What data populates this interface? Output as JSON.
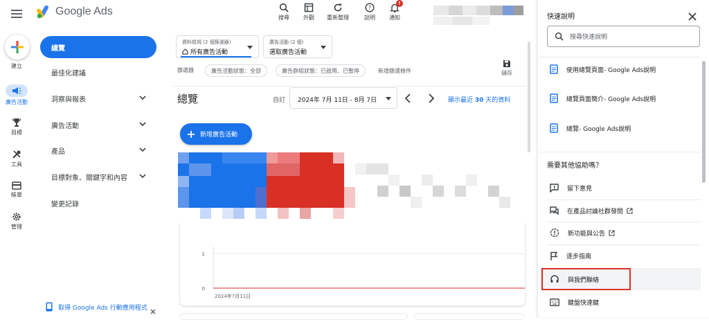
{
  "header": {
    "app_name": "Google Ads",
    "tools": [
      {
        "icon": "search-icon",
        "label": "搜尋"
      },
      {
        "icon": "appearance-icon",
        "label": "外觀"
      },
      {
        "icon": "refresh-icon",
        "label": "重新整理"
      },
      {
        "icon": "help-icon",
        "label": "說明"
      },
      {
        "icon": "bell-icon",
        "label": "通知",
        "badge": "!"
      }
    ]
  },
  "rail": {
    "create_label": "建立",
    "items": [
      {
        "icon": "campaign-icon",
        "label": "廣告活動"
      },
      {
        "icon": "trophy-icon",
        "label": "目標"
      },
      {
        "icon": "tools-icon",
        "label": "工具"
      },
      {
        "icon": "billing-icon",
        "label": "帳單"
      },
      {
        "icon": "gear-icon",
        "label": "管理"
      }
    ]
  },
  "sidebar": {
    "items": [
      {
        "label": "總覽",
        "active": true
      },
      {
        "label": "最佳化建議"
      },
      {
        "label": "洞察與報表",
        "expandable": true
      },
      {
        "label": "廣告活動",
        "expandable": true
      },
      {
        "label": "產品",
        "expandable": true
      },
      {
        "label": "目標對象、關鍵字和內容",
        "expandable": true
      },
      {
        "label": "變更記錄"
      }
    ],
    "promo": "取得 Google Ads 行動應用程式"
  },
  "selectors": {
    "view_caption": "資料檢視 (2 個篩選器)",
    "view_value": "所有廣告活動",
    "campaign_caption": "廣告活動 (2 個)",
    "campaign_value": "選取廣告活動"
  },
  "filters": {
    "label": "篩選器",
    "chips": [
      "廣告活動狀態：全部",
      "廣告群組狀態：已啟用、已暫停"
    ],
    "add": "新增篩選條件",
    "save": "儲存"
  },
  "overview": {
    "title": "總覽",
    "date_label": "自訂",
    "date_range": "2024年 7月 11日 - 8月 7日",
    "show_recent": "顯示最近",
    "recent_days": "30",
    "recent_suffix": "天的資料",
    "new_campaign": "新增廣告活動"
  },
  "chart_data": {
    "type": "line",
    "x": [
      "2024年7月11日"
    ],
    "y_ticks": [
      0,
      1
    ],
    "series": [
      {
        "values": [
          0
        ]
      }
    ],
    "x_tick_label": "2024年7月11日"
  },
  "help": {
    "title": "快速說明",
    "search_placeholder": "搜尋快速說明",
    "articles": [
      "使用總覽頁面- Google Ads說明",
      "總覽頁面簡介- Google Ads說明",
      "總覽- Google Ads說明"
    ],
    "more_help": "需要其他協助嗎？",
    "actions": [
      {
        "icon": "feedback-icon",
        "label": "留下意見",
        "external": false
      },
      {
        "icon": "forum-icon",
        "label": "在產品討論社群發問",
        "external": true
      },
      {
        "icon": "announcement-icon",
        "label": "新功能與公告",
        "external": true
      },
      {
        "icon": "flag-icon",
        "label": "逐步指南",
        "external": false
      },
      {
        "icon": "headset-icon",
        "label": "與我們聯絡",
        "external": false,
        "highlighted": true
      },
      {
        "icon": "keyboard-icon",
        "label": "鍵盤快速鍵",
        "external": false
      }
    ]
  },
  "colors": {
    "accent": "#1a73e8",
    "highlight_border": "#d93025",
    "chart_line": "#e57373"
  }
}
